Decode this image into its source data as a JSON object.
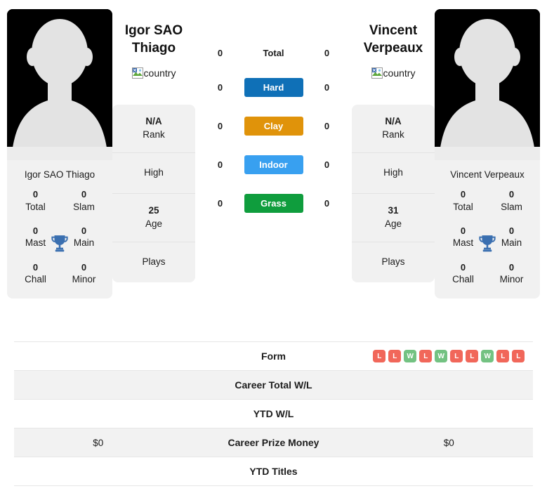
{
  "colors": {
    "hard": "#0f70b7",
    "clay": "#e0930a",
    "indoor": "#38a0f0",
    "grass": "#0f9d3d",
    "win": "#73c282",
    "loss": "#f1675a",
    "trophy": "#3a6fb0",
    "card_bg": "#f1f1f1",
    "row_alt": "#f2f2f2"
  },
  "players": {
    "left": {
      "title": "Igor SAO Thiago",
      "card_name": "Igor SAO Thiago",
      "country_alt": "country",
      "rank_value": "N/A",
      "rank_label": "Rank",
      "high_label": "High",
      "high_value": "",
      "age_value": "25",
      "age_label": "Age",
      "plays_label": "Plays",
      "plays_value": "",
      "titles": [
        {
          "value": "0",
          "label": "Total"
        },
        {
          "value": "0",
          "label": "Slam"
        },
        {
          "value": "0",
          "label": "Mast"
        },
        {
          "value": "0",
          "label": "Main"
        },
        {
          "value": "0",
          "label": "Chall"
        },
        {
          "value": "0",
          "label": "Minor"
        }
      ]
    },
    "right": {
      "title": "Vincent Verpeaux",
      "card_name": "Vincent Verpeaux",
      "country_alt": "country",
      "rank_value": "N/A",
      "rank_label": "Rank",
      "high_label": "High",
      "high_value": "",
      "age_value": "31",
      "age_label": "Age",
      "plays_label": "Plays",
      "plays_value": "",
      "titles": [
        {
          "value": "0",
          "label": "Total"
        },
        {
          "value": "0",
          "label": "Slam"
        },
        {
          "value": "0",
          "label": "Mast"
        },
        {
          "value": "0",
          "label": "Main"
        },
        {
          "value": "0",
          "label": "Chall"
        },
        {
          "value": "0",
          "label": "Minor"
        }
      ]
    }
  },
  "surfaces": [
    {
      "label": "Total",
      "left": "0",
      "right": "0",
      "color": ""
    },
    {
      "label": "Hard",
      "left": "0",
      "right": "0",
      "color": "#0f70b7"
    },
    {
      "label": "Clay",
      "left": "0",
      "right": "0",
      "color": "#e0930a"
    },
    {
      "label": "Indoor",
      "left": "0",
      "right": "0",
      "color": "#38a0f0"
    },
    {
      "label": "Grass",
      "left": "0",
      "right": "0",
      "color": "#0f9d3d"
    }
  ],
  "stats_rows": [
    {
      "label": "Form",
      "left": "",
      "right": "",
      "right_form": [
        "L",
        "L",
        "W",
        "L",
        "W",
        "L",
        "L",
        "W",
        "L",
        "L"
      ]
    },
    {
      "label": "Career Total W/L",
      "left": "",
      "right": ""
    },
    {
      "label": "YTD W/L",
      "left": "",
      "right": ""
    },
    {
      "label": "Career Prize Money",
      "left": "$0",
      "right": "$0"
    },
    {
      "label": "YTD Titles",
      "left": "",
      "right": ""
    }
  ]
}
